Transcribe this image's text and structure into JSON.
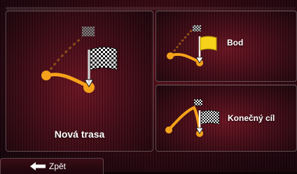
{
  "menu": {
    "new_route": {
      "label": "Nová trasa",
      "icon": "route-checkered-flag-icon"
    },
    "waypoint": {
      "label": "Bod",
      "icon": "route-yellow-flag-icon"
    },
    "final_destination": {
      "label": "Konečný cíl",
      "icon": "route-checkered-flag-icon"
    }
  },
  "footer": {
    "back_label": "Zpět",
    "back_icon": "left-arrow-icon"
  },
  "colors": {
    "route": "#f5a21b",
    "background": "#3a0a14",
    "flag_yellow": "#f6d21a"
  }
}
